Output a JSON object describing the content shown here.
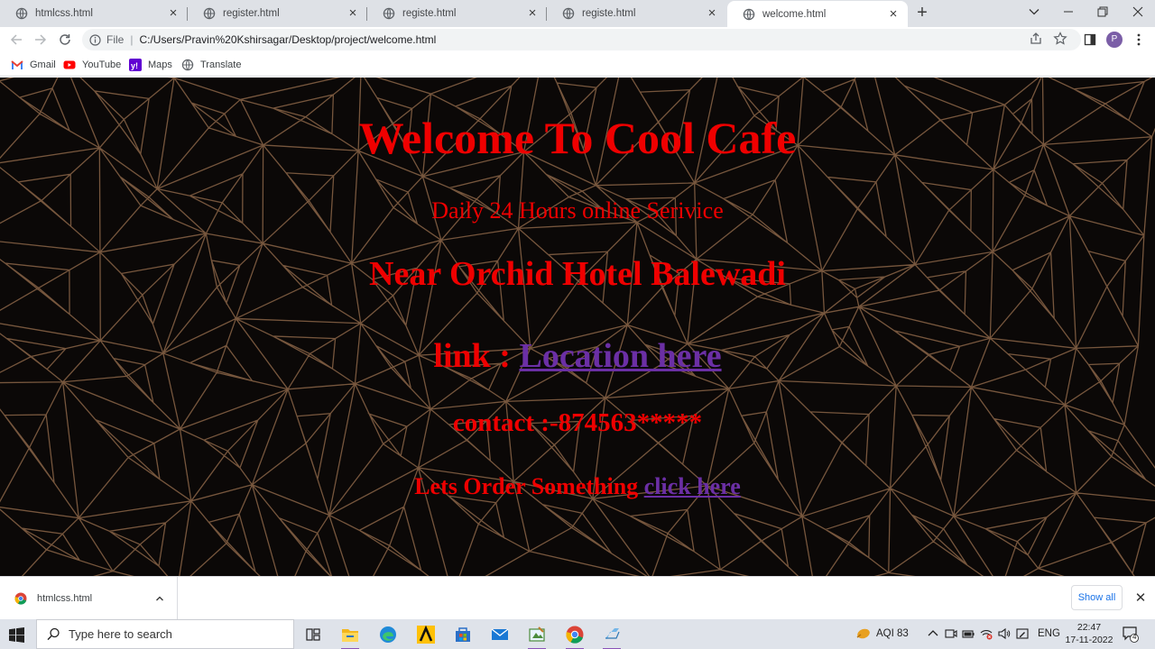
{
  "browser": {
    "tabs": [
      {
        "title": "htmlcss.html",
        "active": false
      },
      {
        "title": "register.html",
        "active": false
      },
      {
        "title": "registe.html",
        "active": false
      },
      {
        "title": "registe.html",
        "active": false
      },
      {
        "title": "welcome.html",
        "active": true
      }
    ],
    "new_tab": "+",
    "address": {
      "scheme_label": "File",
      "url": "C:/Users/Pravin%20Kshirsagar/Desktop/project/welcome.html"
    },
    "profile_initial": "P",
    "bookmarks": [
      {
        "label": "Gmail",
        "icon": "gmail-icon"
      },
      {
        "label": "YouTube",
        "icon": "youtube-icon"
      },
      {
        "label": "Maps",
        "icon": "yahoo-icon"
      },
      {
        "label": "Translate",
        "icon": "translate-icon"
      }
    ]
  },
  "page": {
    "title": "Welcome To Cool Cafe",
    "subtitle": "Daily 24 Hours online Serivice",
    "address_line": "Near Orchid Hotel Balewadi",
    "link_prefix": "link : ",
    "link_text": "Location here",
    "contact": "contact :-874563*****",
    "order_prefix": "Lets Order Something ",
    "order_link": "click here",
    "colors": {
      "text": "#ef0000",
      "link": "#6b2fa5",
      "background": "#0b0807",
      "pattern": "#8a6446"
    }
  },
  "downloads": {
    "item_name": "htmlcss.html",
    "show_all": "Show all",
    "close": "✕"
  },
  "taskbar": {
    "search_placeholder": "Type here to search",
    "apps": [
      "task-view-icon",
      "file-explorer-icon",
      "edge-icon",
      "app-a-icon",
      "store-icon",
      "mail-icon",
      "paint-icon",
      "chrome-icon",
      "notepad-icon"
    ],
    "weather_label": "AQI 83",
    "language": "ENG",
    "time": "22:47",
    "date": "17-11-2022",
    "notification_count": "4"
  }
}
